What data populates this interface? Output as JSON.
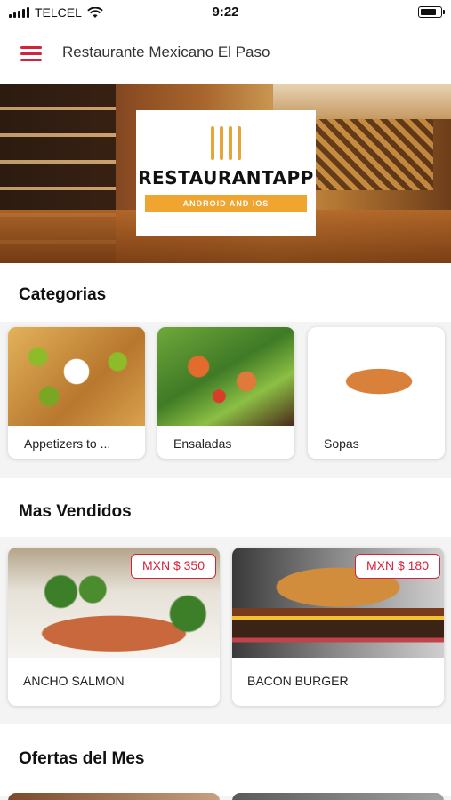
{
  "status_bar": {
    "carrier": "TELCEL",
    "time": "9:22"
  },
  "app_bar": {
    "title": "Restaurante Mexicano El Paso",
    "menu_icon": "hamburger-menu-icon"
  },
  "hero": {
    "logo_name": "RESTAURANTAPP",
    "logo_tagline": "ANDROID AND IOS"
  },
  "categories": {
    "title": "Categorias",
    "items": [
      {
        "label": "Appetizers to ..."
      },
      {
        "label": "Ensaladas"
      },
      {
        "label": "Sopas"
      }
    ]
  },
  "best_sellers": {
    "title": "Mas Vendidos",
    "items": [
      {
        "name": "ANCHO SALMON",
        "price": "MXN $ 350"
      },
      {
        "name": "BACON BURGER",
        "price": "MXN $ 180"
      }
    ]
  },
  "offers": {
    "title": "Ofertas del Mes"
  },
  "colors": {
    "accent": "#d5223a",
    "logo_orange": "#f0a530"
  }
}
